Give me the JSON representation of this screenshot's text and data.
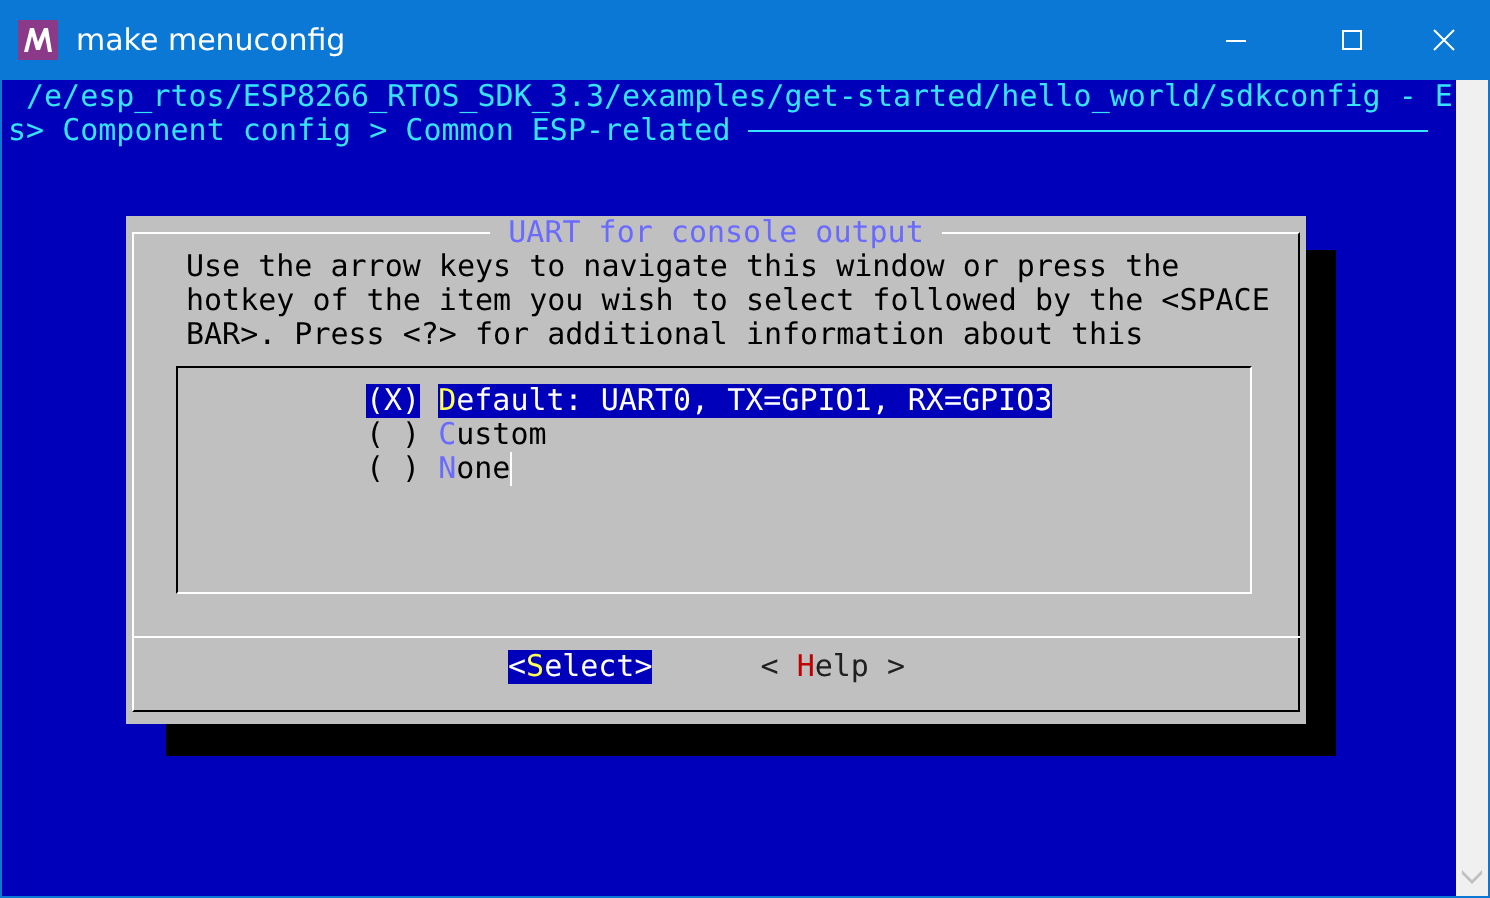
{
  "window": {
    "title": "make menuconfig"
  },
  "header": {
    "path": "/e/esp_rtos/ESP8266_RTOS_SDK_3.3/examples/get-started/hello_world/sdkconfig - E",
    "breadcrumb": "s> Component config > Common ESP-related"
  },
  "dialog": {
    "title": "UART for console output",
    "help_lines": [
      "Use the arrow keys to navigate this window or press the",
      "hotkey of the item you wish to select followed by the <SPACE",
      "BAR>. Press <?> for additional information about this"
    ],
    "options": [
      {
        "marker": "(X)",
        "label": "Default: UART0, TX=GPIO1, RX=GPIO3",
        "selected": true
      },
      {
        "marker": "( )",
        "label": "Custom",
        "selected": false
      },
      {
        "marker": "( )",
        "label": "None",
        "selected": false
      }
    ],
    "buttons": [
      {
        "label": "<Select>",
        "selected": true
      },
      {
        "label": "< Help >",
        "selected": false
      }
    ]
  }
}
